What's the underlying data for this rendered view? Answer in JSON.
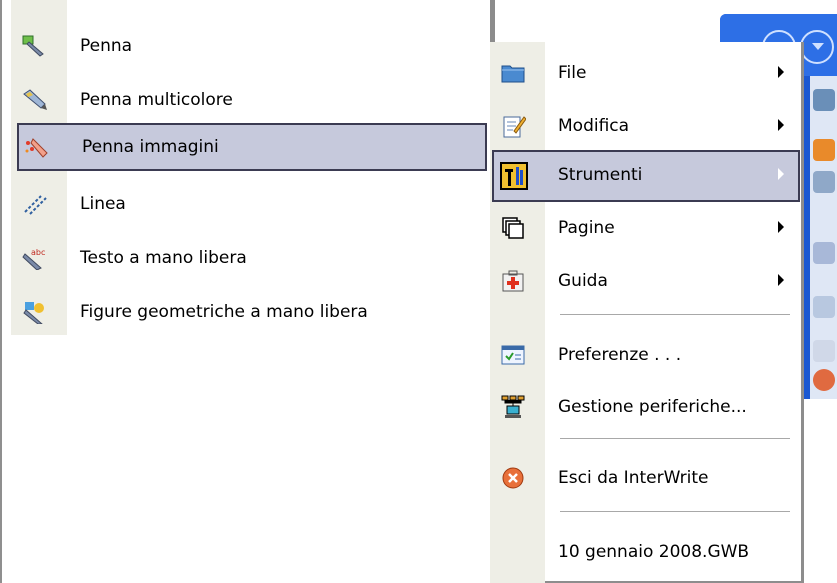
{
  "tools_submenu": {
    "items": [
      {
        "label": "Penna",
        "icon": "pen-icon"
      },
      {
        "label": "Penna multicolore",
        "icon": "multicolor-pen-icon"
      },
      {
        "label": "Penna immagini",
        "icon": "image-pen-icon",
        "highlighted": true
      },
      {
        "label": "Linea",
        "icon": "line-icon"
      },
      {
        "label": "Testo a mano libera",
        "icon": "freehand-text-icon"
      },
      {
        "label": "Figure geometriche a mano libera",
        "icon": "freehand-shapes-icon"
      }
    ]
  },
  "main_menu": {
    "items": [
      {
        "label": "File",
        "icon": "folder-icon",
        "has_submenu": true
      },
      {
        "label": "Modifica",
        "icon": "edit-icon",
        "has_submenu": true
      },
      {
        "label": "Strumenti",
        "icon": "tools-icon",
        "has_submenu": true,
        "highlighted": true
      },
      {
        "label": "Pagine",
        "icon": "pages-icon",
        "has_submenu": true
      },
      {
        "label": "Guida",
        "icon": "help-kit-icon",
        "has_submenu": true
      },
      {
        "label": "Preferenze . . .",
        "icon": "preferences-icon"
      },
      {
        "label": "Gestione periferiche...",
        "icon": "devices-icon"
      },
      {
        "label": "Esci da InterWrite",
        "icon": "exit-icon"
      },
      {
        "label": "10 gennaio 2008.GWB",
        "icon": ""
      }
    ]
  },
  "colors": {
    "highlight": "#c6c9dc",
    "highlight_border": "#3b3b52",
    "gutter": "#eeeee6",
    "toolbar": "#1a58d2"
  }
}
